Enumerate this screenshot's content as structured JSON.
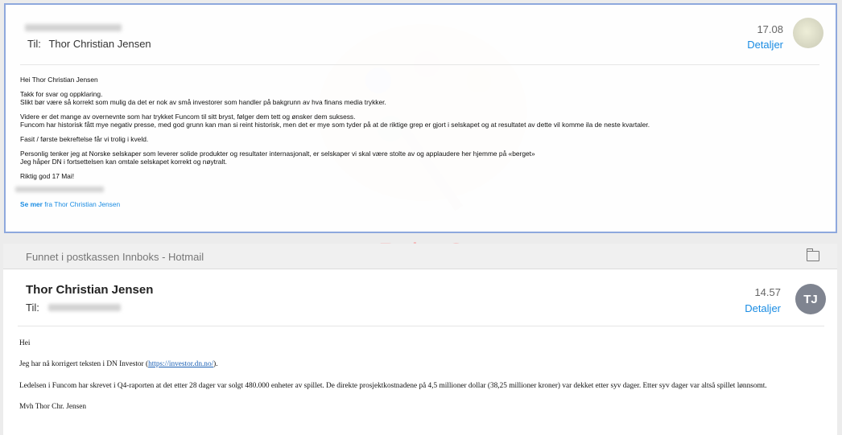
{
  "message1": {
    "to_label": "Til:",
    "to_name": "Thor Christian Jensen",
    "time": "17.08",
    "details_label": "Detaljer",
    "body": [
      "Hei Thor Christian Jensen",
      "Takk for svar og oppklaring.",
      "Slikt bør være så korrekt som mulig da det er nok av små investorer som handler på bakgrunn av hva finans media trykker.",
      "Videre er det mange av overnevnte som har trykket Funcom til sitt bryst, følger dem tett og ønsker dem suksess.",
      "Funcom har historisk fått mye negativ presse, med god grunn kan man si reint historisk, men det er mye som tyder på at de riktige grep er gjort i selskapet og at resultatet av dette vil komme ila de neste kvartaler.",
      "Fasit / første bekreftelse får vi trolig i kveld.",
      "Personlig tenker jeg at Norske selskaper som leverer solide produkter og resultater internasjonalt, er selskaper vi skal være stolte av og applaudere her hjemme på «berget»",
      "Jeg håper DN i fortsettelsen kan omtale selskapet korrekt og nøytralt.",
      "Riktig god 17 Mai!"
    ],
    "see_more_bold": "Se mer",
    "see_more_rest": " fra Thor Christian Jensen"
  },
  "watermark": "Paint 2",
  "found_in": "Funnet i postkassen Innboks - Hotmail",
  "message2": {
    "sender": "Thor Christian Jensen",
    "to_label": "Til:",
    "time": "14.57",
    "details_label": "Detaljer",
    "avatar_initials": "TJ",
    "greeting": "Hei",
    "line1_pre": "Jeg har nå korrigert teksten i DN Investor (",
    "line1_link": "https://investor.dn.no/",
    "line1_post": ").",
    "line2": "Ledelsen i Funcom har skrevet i Q4-raporten at det etter 28 dager var solgt 480.000 enheter av spillet. De direkte prosjektkostnadene på 4,5 millioner dollar (38,25 millioner kroner) var dekket etter syv dager. Etter syv dager var altså spillet lønnsomt.",
    "signature": "Mvh Thor Chr. Jensen"
  }
}
